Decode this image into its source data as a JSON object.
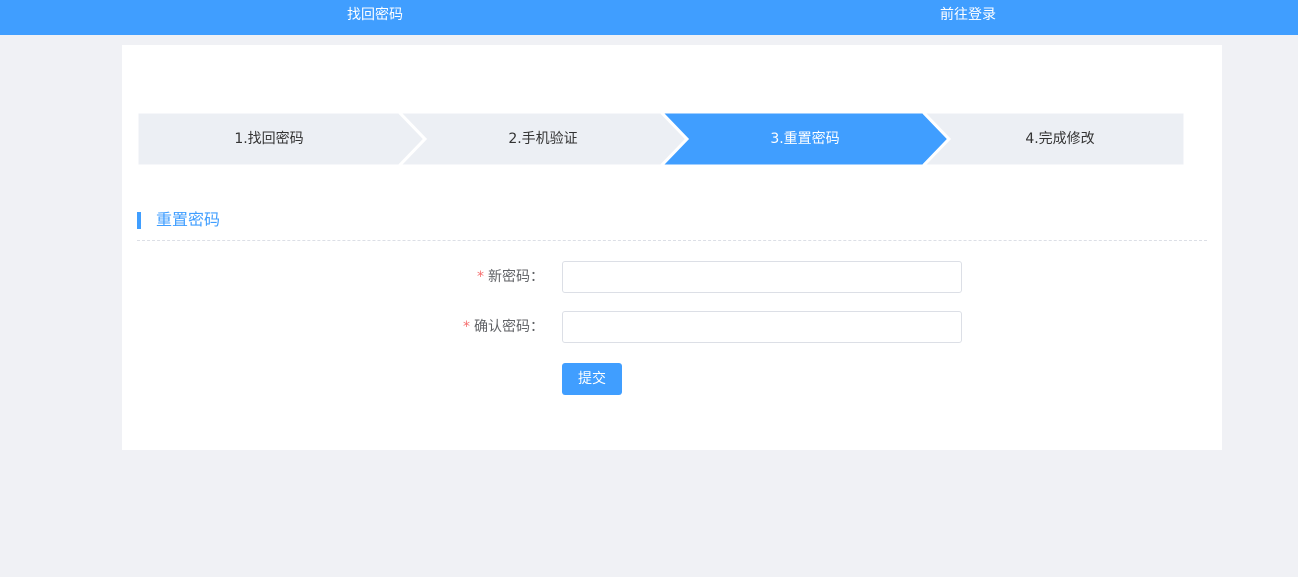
{
  "nav": {
    "left_link": "找回密码",
    "right_link": "前往登录"
  },
  "steps": [
    {
      "label": "1.找回密码",
      "active": false
    },
    {
      "label": "2.手机验证",
      "active": false
    },
    {
      "label": "3.重置密码",
      "active": true
    },
    {
      "label": "4.完成修改",
      "active": false
    }
  ],
  "section": {
    "title": "重置密码"
  },
  "form": {
    "required_mark": "*",
    "new_password_label": "新密码：",
    "new_password_value": "",
    "confirm_password_label": "确认密码：",
    "confirm_password_value": "",
    "submit_label": "提交"
  },
  "colors": {
    "primary": "#409eff",
    "step_inactive": "#eceff4",
    "page_bg": "#f0f1f5",
    "required": "#f56c6c"
  }
}
